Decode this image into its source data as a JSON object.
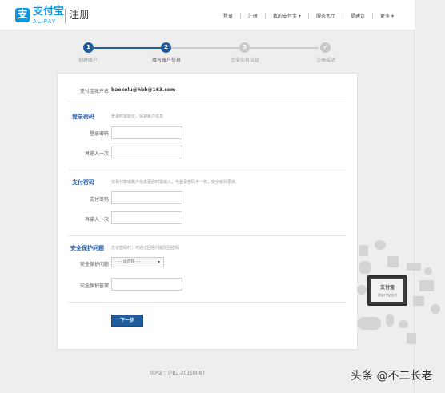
{
  "header": {
    "logo_mark": "支",
    "logo_text": "支付宝",
    "logo_sub": "ALIPAY",
    "page_title": "注册",
    "nav": [
      {
        "label": "登录"
      },
      {
        "label": "注册"
      },
      {
        "label": "我的支付宝",
        "caret": "▾"
      },
      {
        "label": "服务大厅"
      },
      {
        "label": "提建议"
      },
      {
        "label": "更多",
        "caret": "▾"
      }
    ]
  },
  "steps": [
    {
      "num": "1",
      "label": "创建账户"
    },
    {
      "num": "2",
      "label": "填写账户信息"
    },
    {
      "num": "3",
      "label": "企业实名认证"
    },
    {
      "num": "✔",
      "label": "注册成功"
    }
  ],
  "account": {
    "label": "支付宝账户名",
    "value": "baokelu@hbb@163.com"
  },
  "login_pw": {
    "title": "登录密码",
    "desc": "登录时需验证，保护账户信息",
    "field1": "登录密码",
    "field2": "再输入一次"
  },
  "pay_pw": {
    "title": "支付密码",
    "desc": "交易付款或账户信息更改时需输入，与登录密码不一样，安全级别更高",
    "field1": "支付密码",
    "field2": "再输入一次"
  },
  "security": {
    "title": "安全保护问题",
    "desc": "忘记密码时，可通过回答问题找回密码",
    "question_label": "安全保护问题",
    "question_value": "- - 请选择 - -",
    "answer_label": "安全保护答案"
  },
  "next_button": "下一步",
  "icp": "ICP证：沪B2-20150087",
  "monitor": {
    "title": "支付宝",
    "sub": "用支付宝支付"
  },
  "watermark": "头条 @不二长老",
  "colors": {
    "brand": "#1296db",
    "step_active": "#1f5c9c",
    "step_inactive": "#c9c9c9",
    "section_title": "#2b5fa8"
  }
}
